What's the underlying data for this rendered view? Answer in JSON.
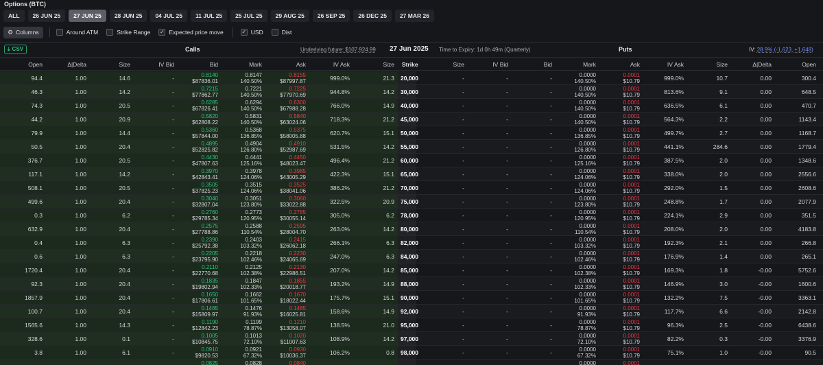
{
  "title": "Options (BTC)",
  "expiries": [
    {
      "label": "ALL",
      "active": false
    },
    {
      "label": "26 JUN 25",
      "active": false
    },
    {
      "label": "27 JUN 25",
      "active": true
    },
    {
      "label": "28 JUN 25",
      "active": false
    },
    {
      "label": "04 JUL 25",
      "active": false
    },
    {
      "label": "11 JUL 25",
      "active": false
    },
    {
      "label": "25 JUL 25",
      "active": false
    },
    {
      "label": "29 AUG 25",
      "active": false
    },
    {
      "label": "26 SEP 25",
      "active": false
    },
    {
      "label": "26 DEC 25",
      "active": false
    },
    {
      "label": "27 MAR 26",
      "active": false
    }
  ],
  "options_bar": {
    "columns_label": "Columns",
    "toggles": [
      {
        "label": "Around ATM",
        "checked": false
      },
      {
        "label": "Strike Range",
        "checked": false
      },
      {
        "label": "Expected price move",
        "checked": true
      },
      {
        "label": "USD",
        "checked": true
      },
      {
        "label": "Dist",
        "checked": false
      }
    ]
  },
  "header": {
    "csv_label": "CSV",
    "calls_label": "Calls",
    "underlying": "Underlying future: $107,924.99",
    "date": "27 Jun 2025",
    "time_to_expiry": "Time to Expiry: 1d 0h 49m (Quarterly)",
    "puts_label": "Puts",
    "iv_label": "IV:",
    "iv_value": "28.9% (-1,623, +1,648)"
  },
  "columns": {
    "calls": [
      "Open",
      "Δ|Delta",
      "Size",
      "IV Bid",
      "Bid",
      "Mark",
      "Ask",
      "IV Ask",
      "Size"
    ],
    "strike": "Strike",
    "puts": [
      "Size",
      "IV Bid",
      "Bid",
      "Mark",
      "Ask",
      "IV Ask",
      "Size",
      "Δ|Delta",
      "Open"
    ]
  },
  "colors": {
    "bid": "#2ec27e",
    "ask": "#ef3a4a",
    "accent": "#6f8cff"
  },
  "rows": [
    {
      "c_open": "94.4",
      "c_delta": "1.00",
      "c_size": "14.6",
      "c_ivbid": "-",
      "c_bid": "0.8140",
      "c_bid_usd": "$87836.01",
      "c_mark": "0.8147",
      "c_mark_iv": "140.50%",
      "c_ask": "0.8155",
      "c_ask_usd": "$87997.87",
      "c_ivask": "999.0%",
      "c_size2": "21.3",
      "strike": "20,000",
      "p_size": "-",
      "p_ivbid": "-",
      "p_bid": "-",
      "p_mark": "0.0000",
      "p_mark_iv": "140.50%",
      "p_ask": "0.0001",
      "p_ask_usd": "$10.79",
      "p_ivask": "999.0%",
      "p_size2": "10.7",
      "p_delta": "0.00",
      "p_open": "300.4"
    },
    {
      "c_open": "46.3",
      "c_delta": "1.00",
      "c_size": "14.2",
      "c_ivbid": "-",
      "c_bid": "0.7215",
      "c_bid_usd": "$77862.77",
      "c_mark": "0.7221",
      "c_mark_iv": "140.50%",
      "c_ask": "0.7225",
      "c_ask_usd": "$77970.69",
      "c_ivask": "944.8%",
      "c_size2": "14.2",
      "strike": "30,000",
      "p_size": "-",
      "p_ivbid": "-",
      "p_bid": "-",
      "p_mark": "0.0000",
      "p_mark_iv": "140.50%",
      "p_ask": "0.0001",
      "p_ask_usd": "$10.79",
      "p_ivask": "813.6%",
      "p_size2": "9.1",
      "p_delta": "0.00",
      "p_open": "648.5"
    },
    {
      "c_open": "74.3",
      "c_delta": "1.00",
      "c_size": "20.5",
      "c_ivbid": "-",
      "c_bid": "0.6285",
      "c_bid_usd": "$67826.41",
      "c_mark": "0.6294",
      "c_mark_iv": "140.50%",
      "c_ask": "0.6300",
      "c_ask_usd": "$67988.28",
      "c_ivask": "766.0%",
      "c_size2": "14.9",
      "strike": "40,000",
      "p_size": "-",
      "p_ivbid": "-",
      "p_bid": "-",
      "p_mark": "0.0000",
      "p_mark_iv": "140.50%",
      "p_ask": "0.0001",
      "p_ask_usd": "$10.79",
      "p_ivask": "636.5%",
      "p_size2": "6.1",
      "p_delta": "0.00",
      "p_open": "470.7"
    },
    {
      "c_open": "44.2",
      "c_delta": "1.00",
      "c_size": "20.9",
      "c_ivbid": "-",
      "c_bid": "0.5820",
      "c_bid_usd": "$62808.22",
      "c_mark": "0.5831",
      "c_mark_iv": "140.50%",
      "c_ask": "0.5840",
      "c_ask_usd": "$63024.06",
      "c_ivask": "718.3%",
      "c_size2": "21.2",
      "strike": "45,000",
      "p_size": "-",
      "p_ivbid": "-",
      "p_bid": "-",
      "p_mark": "0.0000",
      "p_mark_iv": "140.50%",
      "p_ask": "0.0001",
      "p_ask_usd": "$10.79",
      "p_ivask": "564.3%",
      "p_size2": "2.2",
      "p_delta": "0.00",
      "p_open": "1143.4"
    },
    {
      "c_open": "79.9",
      "c_delta": "1.00",
      "c_size": "14.4",
      "c_ivbid": "-",
      "c_bid": "0.5360",
      "c_bid_usd": "$57844.00",
      "c_mark": "0.5368",
      "c_mark_iv": "136.85%",
      "c_ask": "0.5375",
      "c_ask_usd": "$58005.88",
      "c_ivask": "620.7%",
      "c_size2": "15.1",
      "strike": "50,000",
      "p_size": "-",
      "p_ivbid": "-",
      "p_bid": "-",
      "p_mark": "0.0000",
      "p_mark_iv": "136.85%",
      "p_ask": "0.0001",
      "p_ask_usd": "$10.79",
      "p_ivask": "499.7%",
      "p_size2": "2.7",
      "p_delta": "0.00",
      "p_open": "1168.7"
    },
    {
      "c_open": "50.5",
      "c_delta": "1.00",
      "c_size": "20.4",
      "c_ivbid": "-",
      "c_bid": "0.4895",
      "c_bid_usd": "$52825.82",
      "c_mark": "0.4904",
      "c_mark_iv": "126.80%",
      "c_ask": "0.4910",
      "c_ask_usd": "$52987.69",
      "c_ivask": "531.5%",
      "c_size2": "14.2",
      "strike": "55,000",
      "p_size": "-",
      "p_ivbid": "-",
      "p_bid": "-",
      "p_mark": "0.0000",
      "p_mark_iv": "126.80%",
      "p_ask": "0.0001",
      "p_ask_usd": "$10.79",
      "p_ivask": "441.1%",
      "p_size2": "284.6",
      "p_delta": "0.00",
      "p_open": "1779.4"
    },
    {
      "c_open": "376.7",
      "c_delta": "1.00",
      "c_size": "20.5",
      "c_ivbid": "-",
      "c_bid": "0.4430",
      "c_bid_usd": "$47807.63",
      "c_mark": "0.4441",
      "c_mark_iv": "125.16%",
      "c_ask": "0.4450",
      "c_ask_usd": "$48023.47",
      "c_ivask": "496.4%",
      "c_size2": "21.2",
      "strike": "60,000",
      "p_size": "-",
      "p_ivbid": "-",
      "p_bid": "-",
      "p_mark": "0.0000",
      "p_mark_iv": "125.16%",
      "p_ask": "0.0001",
      "p_ask_usd": "$10.79",
      "p_ivask": "387.5%",
      "p_size2": "2.0",
      "p_delta": "0.00",
      "p_open": "1348.6"
    },
    {
      "c_open": "117.1",
      "c_delta": "1.00",
      "c_size": "14.2",
      "c_ivbid": "-",
      "c_bid": "0.3970",
      "c_bid_usd": "$42843.41",
      "c_mark": "0.3978",
      "c_mark_iv": "124.06%",
      "c_ask": "0.3985",
      "c_ask_usd": "$43005.29",
      "c_ivask": "422.3%",
      "c_size2": "15.1",
      "strike": "65,000",
      "p_size": "-",
      "p_ivbid": "-",
      "p_bid": "-",
      "p_mark": "0.0000",
      "p_mark_iv": "124.06%",
      "p_ask": "0.0001",
      "p_ask_usd": "$10.79",
      "p_ivask": "338.0%",
      "p_size2": "2.0",
      "p_delta": "0.00",
      "p_open": "2556.6"
    },
    {
      "c_open": "508.1",
      "c_delta": "1.00",
      "c_size": "20.5",
      "c_ivbid": "-",
      "c_bid": "0.3505",
      "c_bid_usd": "$37825.23",
      "c_mark": "0.3515",
      "c_mark_iv": "124.06%",
      "c_ask": "0.3525",
      "c_ask_usd": "$38041.06",
      "c_ivask": "386.2%",
      "c_size2": "21.2",
      "strike": "70,000",
      "p_size": "-",
      "p_ivbid": "-",
      "p_bid": "-",
      "p_mark": "0.0000",
      "p_mark_iv": "124.06%",
      "p_ask": "0.0001",
      "p_ask_usd": "$10.79",
      "p_ivask": "292.0%",
      "p_size2": "1.5",
      "p_delta": "0.00",
      "p_open": "2608.6"
    },
    {
      "c_open": "499.6",
      "c_delta": "1.00",
      "c_size": "20.4",
      "c_ivbid": "-",
      "c_bid": "0.3040",
      "c_bid_usd": "$32807.04",
      "c_mark": "0.3051",
      "c_mark_iv": "123.80%",
      "c_ask": "0.3060",
      "c_ask_usd": "$33022.88",
      "c_ivask": "322.5%",
      "c_size2": "20.9",
      "strike": "75,000",
      "p_size": "-",
      "p_ivbid": "-",
      "p_bid": "-",
      "p_mark": "0.0000",
      "p_mark_iv": "123.80%",
      "p_ask": "0.0001",
      "p_ask_usd": "$10.79",
      "p_ivask": "248.8%",
      "p_size2": "1.7",
      "p_delta": "0.00",
      "p_open": "2077.9"
    },
    {
      "c_open": "0.3",
      "c_delta": "1.00",
      "c_size": "6.2",
      "c_ivbid": "-",
      "c_bid": "0.2760",
      "c_bid_usd": "$29785.34",
      "c_mark": "0.2773",
      "c_mark_iv": "120.95%",
      "c_ask": "0.2785",
      "c_ask_usd": "$30055.14",
      "c_ivask": "305.0%",
      "c_size2": "6.2",
      "strike": "78,000",
      "p_size": "-",
      "p_ivbid": "-",
      "p_bid": "-",
      "p_mark": "0.0000",
      "p_mark_iv": "120.95%",
      "p_ask": "0.0001",
      "p_ask_usd": "$10.79",
      "p_ivask": "224.1%",
      "p_size2": "2.9",
      "p_delta": "0.00",
      "p_open": "351.5"
    },
    {
      "c_open": "632.9",
      "c_delta": "1.00",
      "c_size": "20.4",
      "c_ivbid": "-",
      "c_bid": "0.2575",
      "c_bid_usd": "$27788.86",
      "c_mark": "0.2588",
      "c_mark_iv": "110.54%",
      "c_ask": "0.2595",
      "c_ask_usd": "$28004.70",
      "c_ivask": "263.0%",
      "c_size2": "14.2",
      "strike": "80,000",
      "p_size": "-",
      "p_ivbid": "-",
      "p_bid": "-",
      "p_mark": "0.0000",
      "p_mark_iv": "110.54%",
      "p_ask": "0.0001",
      "p_ask_usd": "$10.79",
      "p_ivask": "208.0%",
      "p_size2": "2.0",
      "p_delta": "0.00",
      "p_open": "4183.8"
    },
    {
      "c_open": "0.4",
      "c_delta": "1.00",
      "c_size": "6.3",
      "c_ivbid": "-",
      "c_bid": "0.2390",
      "c_bid_usd": "$25792.38",
      "c_mark": "0.2403",
      "c_mark_iv": "103.32%",
      "c_ask": "0.2415",
      "c_ask_usd": "$26062.18",
      "c_ivask": "266.1%",
      "c_size2": "6.3",
      "strike": "82,000",
      "p_size": "-",
      "p_ivbid": "-",
      "p_bid": "-",
      "p_mark": "0.0000",
      "p_mark_iv": "103.32%",
      "p_ask": "0.0001",
      "p_ask_usd": "$10.79",
      "p_ivask": "192.3%",
      "p_size2": "2.1",
      "p_delta": "0.00",
      "p_open": "266.8"
    },
    {
      "c_open": "0.6",
      "c_delta": "1.00",
      "c_size": "6.3",
      "c_ivbid": "-",
      "c_bid": "0.2205",
      "c_bid_usd": "$23795.90",
      "c_mark": "0.2218",
      "c_mark_iv": "102.46%",
      "c_ask": "0.2230",
      "c_ask_usd": "$24065.69",
      "c_ivask": "247.0%",
      "c_size2": "6.3",
      "strike": "84,000",
      "p_size": "-",
      "p_ivbid": "-",
      "p_bid": "-",
      "p_mark": "0.0000",
      "p_mark_iv": "102.46%",
      "p_ask": "0.0001",
      "p_ask_usd": "$10.79",
      "p_ivask": "176.9%",
      "p_size2": "1.4",
      "p_delta": "0.00",
      "p_open": "265.1"
    },
    {
      "c_open": "1720.4",
      "c_delta": "1.00",
      "c_size": "20.4",
      "c_ivbid": "-",
      "c_bid": "0.2110",
      "c_bid_usd": "$22770.68",
      "c_mark": "0.2125",
      "c_mark_iv": "102.38%",
      "c_ask": "0.2130",
      "c_ask_usd": "$22986.51",
      "c_ivask": "207.0%",
      "c_size2": "14.2",
      "strike": "85,000",
      "p_size": "-",
      "p_ivbid": "-",
      "p_bid": "-",
      "p_mark": "0.0000",
      "p_mark_iv": "102.38%",
      "p_ask": "0.0001",
      "p_ask_usd": "$10.79",
      "p_ivask": "169.3%",
      "p_size2": "1.8",
      "p_delta": "-0.00",
      "p_open": "5752.6"
    },
    {
      "c_open": "92.3",
      "c_delta": "1.00",
      "c_size": "20.4",
      "c_ivbid": "-",
      "c_bid": "0.1835",
      "c_bid_usd": "$19802.94",
      "c_mark": "0.1847",
      "c_mark_iv": "102.33%",
      "c_ask": "0.1855",
      "c_ask_usd": "$20018.77",
      "c_ivask": "193.2%",
      "c_size2": "14.9",
      "strike": "88,000",
      "p_size": "-",
      "p_ivbid": "-",
      "p_bid": "-",
      "p_mark": "0.0000",
      "p_mark_iv": "102.33%",
      "p_ask": "0.0001",
      "p_ask_usd": "$10.79",
      "p_ivask": "146.9%",
      "p_size2": "3.0",
      "p_delta": "-0.00",
      "p_open": "1600.6"
    },
    {
      "c_open": "1857.9",
      "c_delta": "1.00",
      "c_size": "20.4",
      "c_ivbid": "-",
      "c_bid": "0.1650",
      "c_bid_usd": "$17806.61",
      "c_mark": "0.1662",
      "c_mark_iv": "101.65%",
      "c_ask": "0.1670",
      "c_ask_usd": "$18022.44",
      "c_ivask": "175.7%",
      "c_size2": "15.1",
      "strike": "90,000",
      "p_size": "-",
      "p_ivbid": "-",
      "p_bid": "-",
      "p_mark": "0.0000",
      "p_mark_iv": "101.65%",
      "p_ask": "0.0001",
      "p_ask_usd": "$10.79",
      "p_ivask": "132.2%",
      "p_size2": "7.5",
      "p_delta": "-0.00",
      "p_open": "3363.1"
    },
    {
      "c_open": "100.7",
      "c_delta": "1.00",
      "c_size": "20.4",
      "c_ivbid": "-",
      "c_bid": "0.1465",
      "c_bid_usd": "$15809.97",
      "c_mark": "0.1476",
      "c_mark_iv": "91.93%",
      "c_ask": "0.1485",
      "c_ask_usd": "$16025.81",
      "c_ivask": "158.6%",
      "c_size2": "14.9",
      "strike": "92,000",
      "p_size": "-",
      "p_ivbid": "-",
      "p_bid": "-",
      "p_mark": "0.0000",
      "p_mark_iv": "91.93%",
      "p_ask": "0.0001",
      "p_ask_usd": "$10.79",
      "p_ivask": "117.7%",
      "p_size2": "6.6",
      "p_delta": "-0.00",
      "p_open": "2142.8"
    },
    {
      "c_open": "1565.6",
      "c_delta": "1.00",
      "c_size": "14.3",
      "c_ivbid": "-",
      "c_bid": "0.1190",
      "c_bid_usd": "$12842.23",
      "c_mark": "0.1199",
      "c_mark_iv": "78.87%",
      "c_ask": "0.1210",
      "c_ask_usd": "$13058.07",
      "c_ivask": "138.5%",
      "c_size2": "21.0",
      "strike": "95,000",
      "p_size": "-",
      "p_ivbid": "-",
      "p_bid": "-",
      "p_mark": "0.0000",
      "p_mark_iv": "78.87%",
      "p_ask": "0.0001",
      "p_ask_usd": "$10.79",
      "p_ivask": "96.3%",
      "p_size2": "2.5",
      "p_delta": "-0.00",
      "p_open": "6438.6"
    },
    {
      "c_open": "328.6",
      "c_delta": "1.00",
      "c_size": "0.1",
      "c_ivbid": "-",
      "c_bid": "0.1005",
      "c_bid_usd": "$10845.75",
      "c_mark": "0.1013",
      "c_mark_iv": "72.10%",
      "c_ask": "0.1020",
      "c_ask_usd": "$11007.63",
      "c_ivask": "108.9%",
      "c_size2": "14.2",
      "strike": "97,000",
      "p_size": "-",
      "p_ivbid": "-",
      "p_bid": "-",
      "p_mark": "0.0000",
      "p_mark_iv": "72.10%",
      "p_ask": "0.0001",
      "p_ask_usd": "$10.79",
      "p_ivask": "82.2%",
      "p_size2": "0.3",
      "p_delta": "-0.00",
      "p_open": "3376.9"
    },
    {
      "c_open": "3.8",
      "c_delta": "1.00",
      "c_size": "6.1",
      "c_ivbid": "-",
      "c_bid": "0.0910",
      "c_bid_usd": "$9820.53",
      "c_mark": "0.0921",
      "c_mark_iv": "67.32%",
      "c_ask": "0.0930",
      "c_ask_usd": "$10036.37",
      "c_ivask": "106.2%",
      "c_size2": "0.8",
      "strike": "98,000",
      "p_size": "-",
      "p_ivbid": "-",
      "p_bid": "-",
      "p_mark": "0.0000",
      "p_mark_iv": "67.32%",
      "p_ask": "0.0001",
      "p_ask_usd": "$10.79",
      "p_ivask": "75.1%",
      "p_size2": "1.0",
      "p_delta": "-0.00",
      "p_open": "90.5"
    },
    {
      "c_open": "",
      "c_delta": "",
      "c_size": "",
      "c_ivbid": "",
      "c_bid": "0.0825",
      "c_bid_usd": "",
      "c_mark": "0.0828",
      "c_mark_iv": "",
      "c_ask": "0.0840",
      "c_ask_usd": "",
      "c_ivask": "",
      "c_size2": "",
      "strike": "",
      "p_size": "",
      "p_ivbid": "",
      "p_bid": "",
      "p_mark": "0.0000",
      "p_mark_iv": "",
      "p_ask": "0.0001",
      "p_ask_usd": "",
      "p_ivask": "",
      "p_size2": "",
      "p_delta": "",
      "p_open": ""
    }
  ]
}
